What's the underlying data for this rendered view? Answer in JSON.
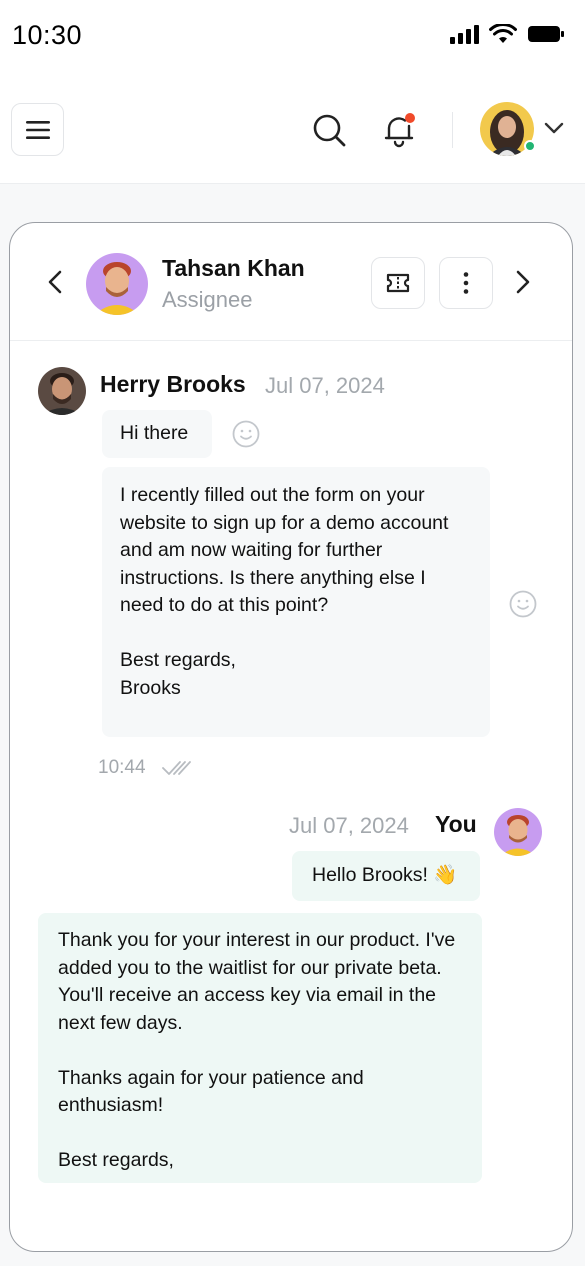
{
  "status_bar": {
    "time": "10:30"
  },
  "header": {
    "menu_icon": "hamburger-menu-icon",
    "search_icon": "search-icon",
    "notification_icon": "bell-icon",
    "notification_dot_color": "#f04a2a",
    "user_status_color": "#22b573"
  },
  "conversation": {
    "contact_name": "Tahsan Khan",
    "contact_role": "Assignee",
    "accent_avatar_bg": "#c79cf0"
  },
  "messages": [
    {
      "sender": "Herry Brooks",
      "date": "Jul 07, 2024",
      "bubbles": [
        "Hi there",
        "I recently filled out the form on your website to sign up for a demo account and am now waiting for further instructions. Is there anything else I need to do at this point?\n\nBest regards,\nBrooks"
      ],
      "time": "10:44"
    },
    {
      "sender": "You",
      "date": "Jul 07, 2024",
      "bubbles": [
        "Hello Brooks! 👋",
        "Thank you for your interest in our product. I've added you to the waitlist for our private beta. You'll receive an access key via email in the next few days.\n\nThanks again for your patience and enthusiasm!\n\nBest regards,"
      ]
    }
  ]
}
